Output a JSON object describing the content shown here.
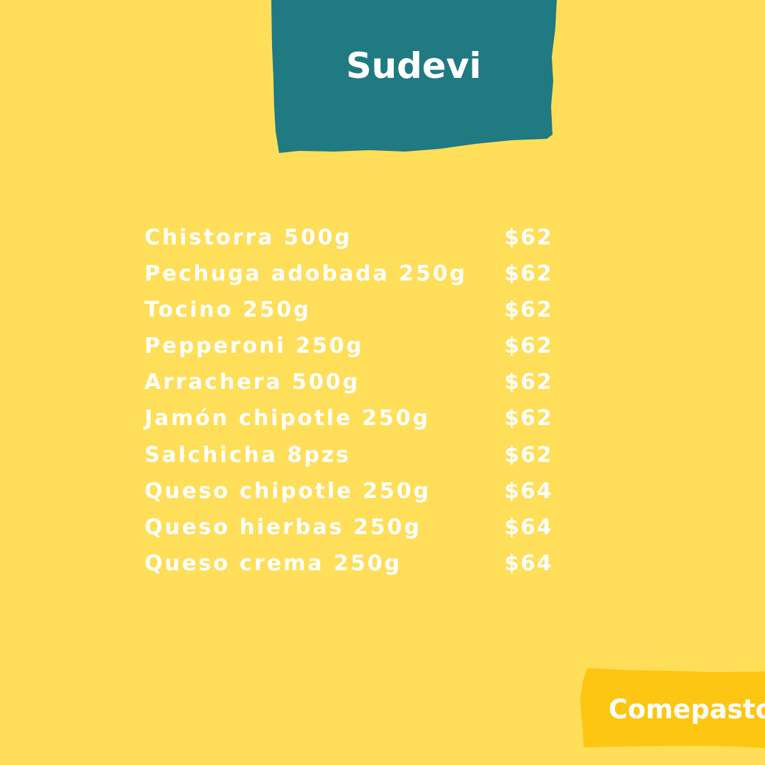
{
  "header": {
    "title": "Sudevi"
  },
  "menu": {
    "items": [
      {
        "name": "Chistorra 500g",
        "price": "$62"
      },
      {
        "name": "Pechuga adobada 250g",
        "price": "$62"
      },
      {
        "name": "Tocino 250g",
        "price": "$62"
      },
      {
        "name": "Pepperoni 250g",
        "price": "$62"
      },
      {
        "name": "Arrachera 500g",
        "price": "$62"
      },
      {
        "name": "Jamón chipotle 250g",
        "price": "$62"
      },
      {
        "name": "Salchicha 8pzs",
        "price": "$62"
      },
      {
        "name": "Queso chipotle 250g",
        "price": "$64"
      },
      {
        "name": "Queso hierbas 250g",
        "price": "$64"
      },
      {
        "name": "Queso crema 250g",
        "price": "$64"
      }
    ]
  },
  "footer": {
    "brand": "Comepasto"
  },
  "colors": {
    "background": "#FFDE59",
    "title_panel": "#1F7A82",
    "brand_panel": "#FDC612",
    "text": "#FFFFFF"
  }
}
